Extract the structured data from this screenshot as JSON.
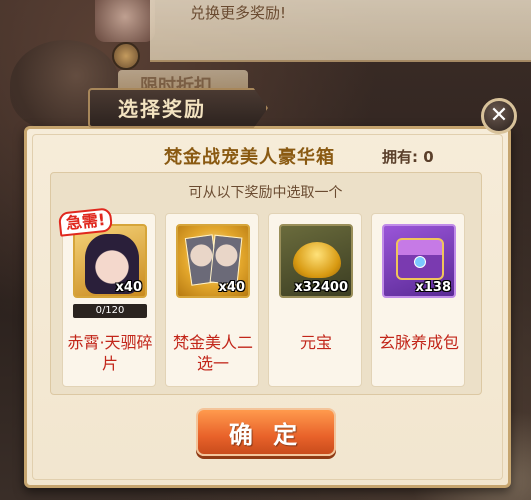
{
  "background": {
    "top_notice": "兑换更多奖励!",
    "tab_label": "限时折扣"
  },
  "dialog": {
    "title": "选择奖励",
    "box_name": "梵金战宠美人豪华箱",
    "owned_label": "拥有: 0",
    "hint": "可从以下奖励中选取一个",
    "confirm_label": "确 定",
    "close_icon": "close-x-icon"
  },
  "rewards": [
    {
      "name": "赤霄·天驷碎片",
      "quantity": "x40",
      "badge": "急需!",
      "progress_text": "0/120",
      "progress_fraction": 0,
      "icon": "character-portrait-icon",
      "frame_color": "#d6a53a"
    },
    {
      "name": "梵金美人二选一",
      "quantity": "x40",
      "icon": "dual-portrait-icon",
      "frame_color": "#d6a53a"
    },
    {
      "name": "元宝",
      "quantity": "x32400",
      "icon": "gold-ingot-icon",
      "frame_color": "#9a8f5a"
    },
    {
      "name": "玄脉养成包",
      "quantity": "x138",
      "icon": "purple-chest-icon",
      "frame_color": "#c08ce8"
    }
  ],
  "colors": {
    "reward_name": "#c2261a",
    "box_name": "#8a5a12",
    "confirm_button": "#e8622a"
  }
}
